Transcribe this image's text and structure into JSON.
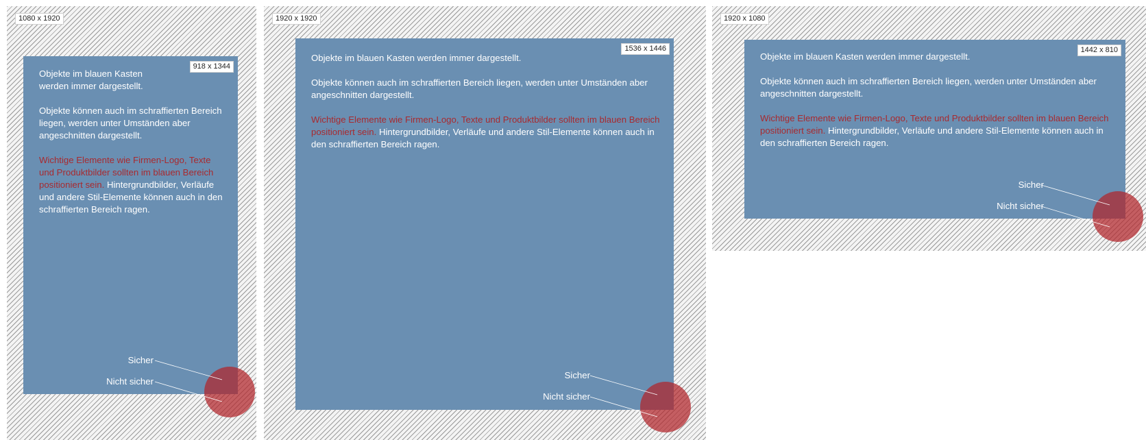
{
  "panels": [
    {
      "id": "portrait",
      "canvas_label": "1080 x 1920",
      "safe_label": "918 x 1344",
      "text_1": "Objekte im blauen Kasten werden immer dargestellt.",
      "text_2": "Objekte können auch im schraffierten Bereich liegen, werden unter Umständen aber angeschnitten dargestellt.",
      "warning": "Wichtige Elemente wie Firmen-Logo, Texte und Produktbilder sollten im blauen Bereich positioniert sein.",
      "text_3": "Hintergrundbilder, Verläufe und andere Stil-Elemente können auch in den schraffierten Bereich ragen.",
      "label_safe": "Sicher",
      "label_unsafe": "Nicht sicher"
    },
    {
      "id": "square",
      "canvas_label": "1920 x 1920",
      "safe_label": "1536 x 1446",
      "text_1": "Objekte im blauen Kasten werden immer dargestellt.",
      "text_2": "Objekte können auch im schraffierten Bereich liegen, werden unter Umständen aber angeschnitten dargestellt.",
      "warning": "Wichtige Elemente wie Firmen-Logo, Texte und Produktbilder sollten im blauen Bereich positioniert sein.",
      "text_3": "Hintergrundbilder, Verläufe und andere Stil-Elemente können auch in den schraffierten Bereich ragen.",
      "label_safe": "Sicher",
      "label_unsafe": "Nicht sicher"
    },
    {
      "id": "landscape",
      "canvas_label": "1920 x 1080",
      "safe_label": "1442 x 810",
      "text_1": "Objekte im blauen Kasten werden immer dargestellt.",
      "text_2": "Objekte können auch im schraffierten Bereich liegen, werden unter Umständen aber angeschnitten dargestellt.",
      "warning": "Wichtige Elemente wie Firmen-Logo, Texte und Produktbilder sollten im blauen Bereich positioniert sein.",
      "text_3": "Hintergrundbilder, Verläufe und andere Stil-Elemente können auch in den schraffierten Bereich ragen.",
      "label_safe": "Sicher",
      "label_unsafe": "Nicht sicher"
    }
  ],
  "colors": {
    "safe_area": "#6a8fb2",
    "warning_text": "#a82a2f",
    "marker_circle": "#b1242a"
  }
}
